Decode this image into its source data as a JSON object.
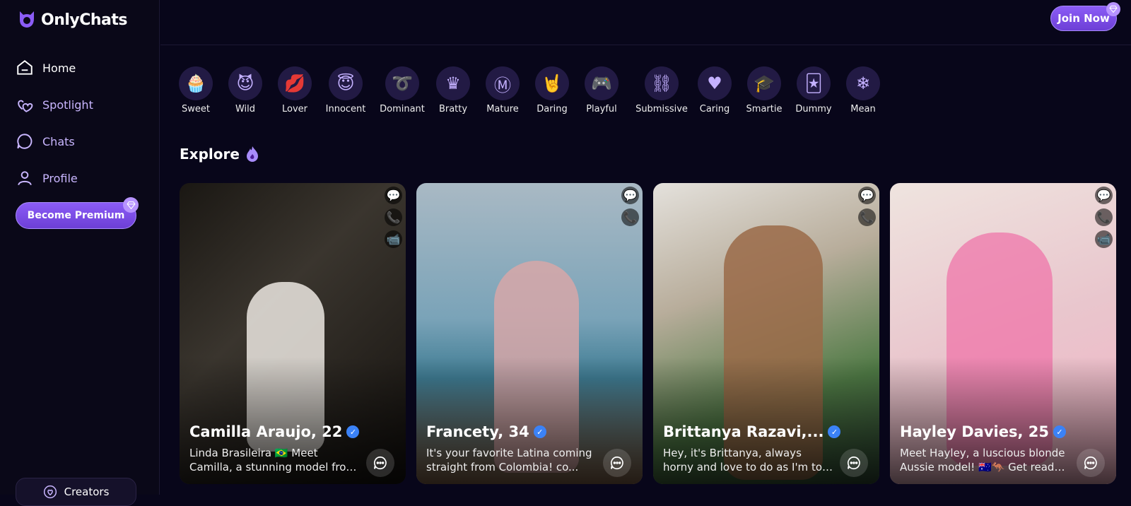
{
  "app": {
    "name": "OnlyChats",
    "brand_color": "#8b5cf6"
  },
  "sidebar": {
    "items": [
      {
        "label": "Home",
        "icon": "home-icon"
      },
      {
        "label": "Spotlight",
        "icon": "hearts-icon"
      },
      {
        "label": "Chats",
        "icon": "chat-bubble-icon"
      },
      {
        "label": "Profile",
        "icon": "user-icon"
      }
    ],
    "premium_label": "Become Premium",
    "creators_label": "Creators"
  },
  "header": {
    "join_label": "Join Now"
  },
  "categories": [
    {
      "label": "Sweet",
      "icon": "cupcake-icon"
    },
    {
      "label": "Wild",
      "icon": "devil-icon"
    },
    {
      "label": "Lover",
      "icon": "lips-icon"
    },
    {
      "label": "Innocent",
      "icon": "angel-face-icon"
    },
    {
      "label": "Dominant",
      "icon": "whip-icon"
    },
    {
      "label": "Bratty",
      "icon": "crown-icon"
    },
    {
      "label": "Mature",
      "icon": "m-badge-icon"
    },
    {
      "label": "Daring",
      "icon": "rock-hand-icon"
    },
    {
      "label": "Playful",
      "icon": "gamepad-icon"
    },
    {
      "label": "Submissive",
      "icon": "handcuffs-icon"
    },
    {
      "label": "Caring",
      "icon": "heart-icon"
    },
    {
      "label": "Smartie",
      "icon": "graduation-cap-icon"
    },
    {
      "label": "Dummy",
      "icon": "jester-hat-icon"
    },
    {
      "label": "Mean",
      "icon": "snowflake-icon"
    }
  ],
  "explore": {
    "title": "Explore",
    "icon": "flame-icon"
  },
  "cards": [
    {
      "name": "Camilla Araujo, 22",
      "desc": "Linda Brasileira 🇧🇷 Meet Camilla, a stunning model from Brazil. I...",
      "bg": "#2d2a26",
      "accent": "#f4f1ec"
    },
    {
      "name": "Francety, 34",
      "desc": "It's your favorite Latina coming straight from Colombia! co...",
      "bg": "#6f7f8c",
      "accent": "#d69aa0"
    },
    {
      "name": "Brittanya Razavi,...",
      "desc": "Hey, it's Brittanya, always horny and love to do as I'm told 💕 ...",
      "bg": "#b9b1a5",
      "accent": "#8a5a3a"
    },
    {
      "name": "Hayley Davies, 25",
      "desc": "Meet Hayley, a luscious blonde Aussie model! 🇦🇺🦘 Get ready fo...",
      "bg": "#e8c6cf",
      "accent": "#f06fa6"
    }
  ]
}
